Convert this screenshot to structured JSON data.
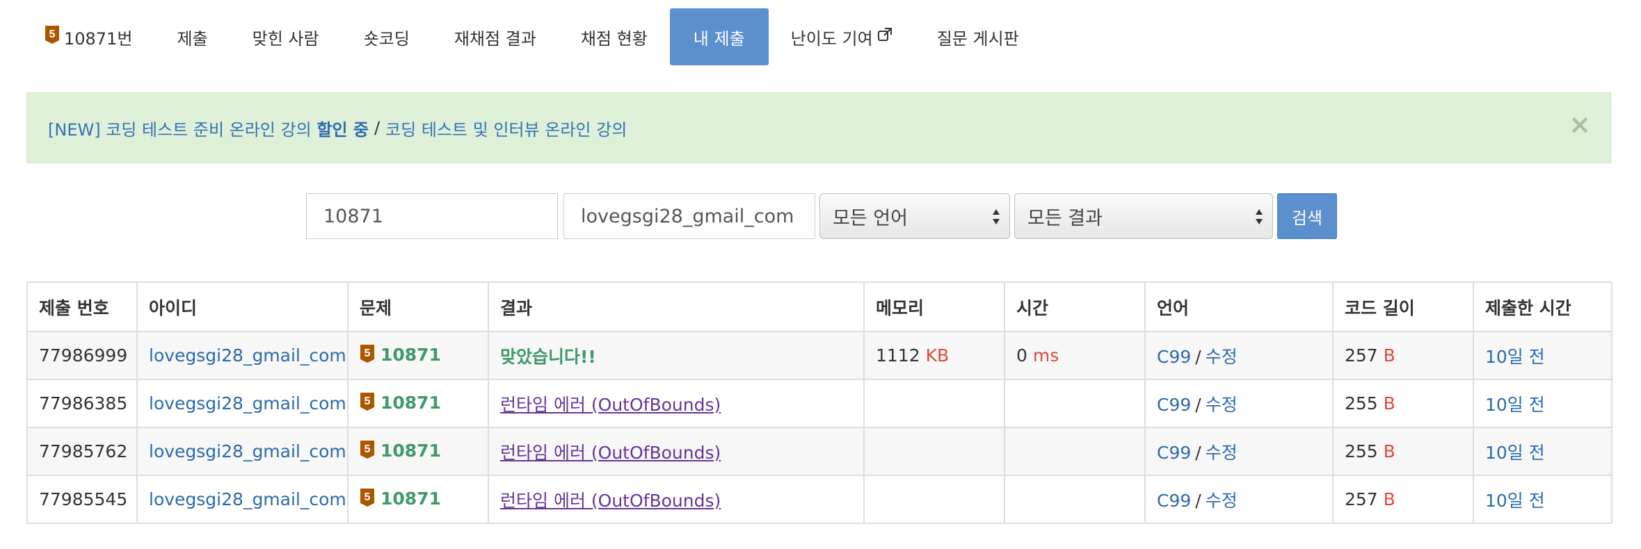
{
  "nav": {
    "problem_tier": "5",
    "problem_label": "10871번",
    "items": [
      "제출",
      "맞힌 사람",
      "숏코딩",
      "재채점 결과",
      "채점 현황",
      "내 제출",
      "난이도 기여",
      "질문 게시판"
    ],
    "active_index": 5,
    "external_icon": "external-link-icon"
  },
  "alert": {
    "link_text": "[NEW] 코딩 테스트 준비 온라인 강의",
    "bold_text": "할인 중",
    "separator": "/",
    "link2_text": "코딩 테스트 및 인터뷰 온라인 강의",
    "close_glyph": "×"
  },
  "form": {
    "problem_value": "10871",
    "user_value": "lovegsgi28_gmail_com",
    "language_selected": "모든 언어",
    "result_selected": "모든 결과",
    "search_label": "검색"
  },
  "table": {
    "headers": [
      "제출 번호",
      "아이디",
      "문제",
      "결과",
      "메모리",
      "시간",
      "언어",
      "코드 길이",
      "제출한 시간"
    ],
    "rows": [
      {
        "id": "77986999",
        "user": "lovegsgi28_gmail_com",
        "tier": "5",
        "problem": "10871",
        "result": "맞았습니다!!",
        "memory": "1112",
        "memory_unit": "KB",
        "time": "0",
        "time_unit": "ms",
        "lang": "C99",
        "edit": "수정",
        "length": "257",
        "length_unit": "B",
        "submitted": "10일 전"
      },
      {
        "id": "77986385",
        "user": "lovegsgi28_gmail_com",
        "tier": "5",
        "problem": "10871",
        "result": "런타임 에러 (OutOfBounds)",
        "memory": "",
        "memory_unit": "",
        "time": "",
        "time_unit": "",
        "lang": "C99",
        "edit": "수정",
        "length": "255",
        "length_unit": "B",
        "submitted": "10일 전"
      },
      {
        "id": "77985762",
        "user": "lovegsgi28_gmail_com",
        "tier": "5",
        "problem": "10871",
        "result": "런타임 에러 (OutOfBounds)",
        "memory": "",
        "memory_unit": "",
        "time": "",
        "time_unit": "",
        "lang": "C99",
        "edit": "수정",
        "length": "255",
        "length_unit": "B",
        "submitted": "10일 전"
      },
      {
        "id": "77985545",
        "user": "lovegsgi28_gmail_com",
        "tier": "5",
        "problem": "10871",
        "result": "런타임 에러 (OutOfBounds)",
        "memory": "",
        "memory_unit": "",
        "time": "",
        "time_unit": "",
        "lang": "C99",
        "edit": "수정",
        "length": "257",
        "length_unit": "B",
        "submitted": "10일 전"
      }
    ]
  },
  "colors": {
    "accent": "#5b8fcd",
    "link": "#2a6ab0",
    "accepted": "#3f9968",
    "runtime_error": "#663399",
    "unit": "#e0483a",
    "alert_bg": "#dff0d8",
    "tier_bronze": "#ad5600"
  }
}
